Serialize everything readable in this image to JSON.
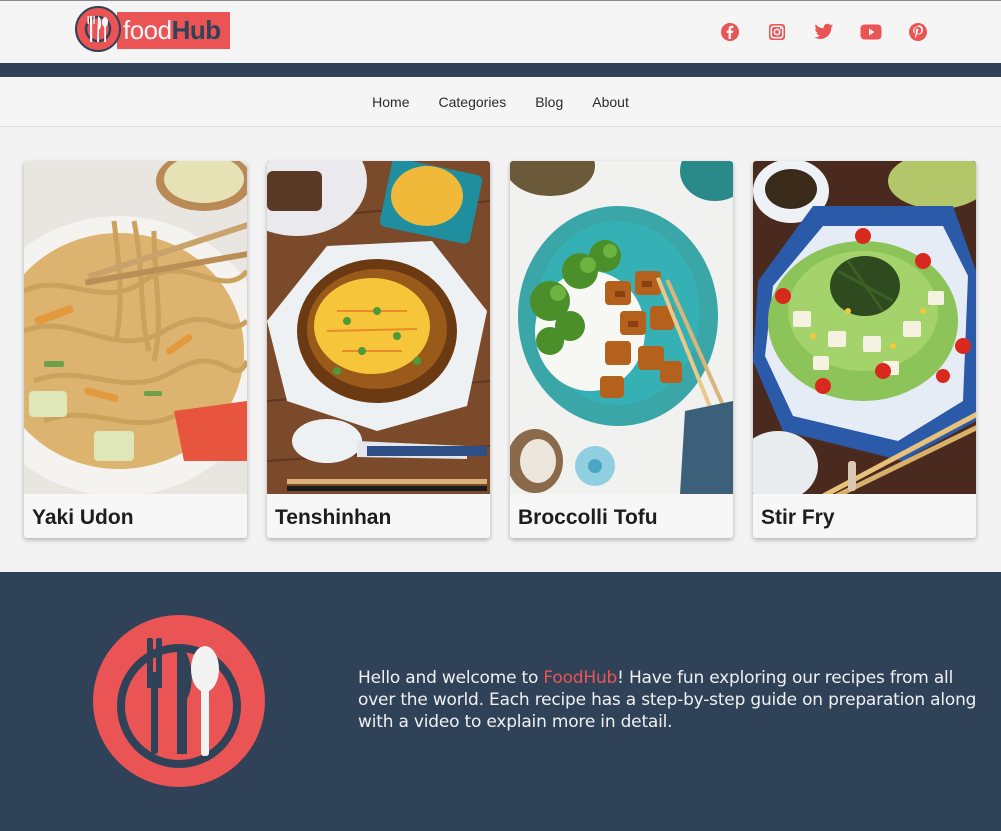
{
  "header": {
    "logo": {
      "food": "food",
      "hub": "Hub"
    },
    "socials": [
      {
        "name": "facebook-icon"
      },
      {
        "name": "instagram-icon"
      },
      {
        "name": "twitter-icon"
      },
      {
        "name": "youtube-icon"
      },
      {
        "name": "pinterest-icon"
      }
    ]
  },
  "nav": {
    "items": [
      {
        "label": "Home"
      },
      {
        "label": "Categories"
      },
      {
        "label": "Blog"
      },
      {
        "label": "About"
      }
    ]
  },
  "cards": [
    {
      "title": "Yaki Udon"
    },
    {
      "title": "Tenshinhan"
    },
    {
      "title": "Broccolli Tofu"
    },
    {
      "title": "Stir Fry"
    }
  ],
  "footer": {
    "text_before": "Hello and welcome to ",
    "brand": "FoodHub",
    "text_after": "! Have fun exploring our recipes from all over the world. Each recipe has a step-by-step guide on preparation along with a video to explain more in detail."
  },
  "colors": {
    "accent": "#ea5455",
    "navy": "#2f4258"
  }
}
